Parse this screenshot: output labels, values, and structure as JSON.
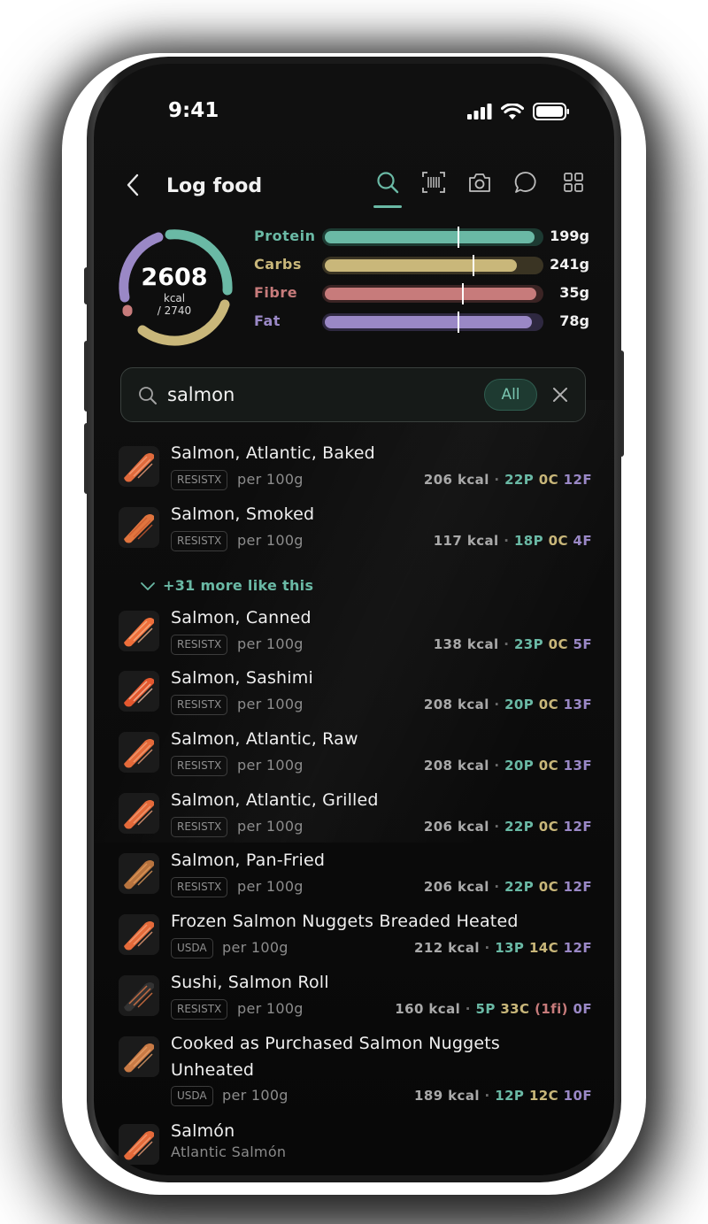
{
  "status": {
    "time": "9:41"
  },
  "header": {
    "title": "Log food"
  },
  "summary": {
    "kcal": "2608",
    "unit": "kcal",
    "goal": "/ 2740",
    "calorie_progress": 0.952
  },
  "macros": [
    {
      "label": "Protein",
      "value": "199g",
      "fill": 0.97,
      "target": 0.61,
      "color": "#6ab9a5",
      "track": "#1d3a32"
    },
    {
      "label": "Carbs",
      "value": "241g",
      "fill": 0.89,
      "target": 0.68,
      "color": "#c9b77a",
      "track": "#3a3423"
    },
    {
      "label": "Fibre",
      "value": "35g",
      "fill": 0.98,
      "target": 0.63,
      "color": "#c77b7b",
      "track": "#3b2424"
    },
    {
      "label": "Fat",
      "value": "78g",
      "fill": 0.96,
      "target": 0.61,
      "color": "#9a88c6",
      "track": "#2e2840"
    }
  ],
  "search": {
    "query": "salmon",
    "filter": "All"
  },
  "more_link": "+31 more like this",
  "foods": [
    {
      "name": "Salmon, Atlantic, Baked",
      "source": "RESISTX",
      "per": "per 100g",
      "kcal": "206 kcal",
      "p": "22P",
      "c": "0C",
      "f": "12F"
    },
    {
      "name": "Salmon, Smoked",
      "source": "RESISTX",
      "per": "per 100g",
      "kcal": "117 kcal",
      "p": "18P",
      "c": "0C",
      "f": "4F"
    },
    {
      "name": "Salmon, Canned",
      "source": "RESISTX",
      "per": "per 100g",
      "kcal": "138 kcal",
      "p": "23P",
      "c": "0C",
      "f": "5F"
    },
    {
      "name": "Salmon, Sashimi",
      "source": "RESISTX",
      "per": "per 100g",
      "kcal": "208 kcal",
      "p": "20P",
      "c": "0C",
      "f": "13F"
    },
    {
      "name": "Salmon, Atlantic, Raw",
      "source": "RESISTX",
      "per": "per 100g",
      "kcal": "208 kcal",
      "p": "20P",
      "c": "0C",
      "f": "13F"
    },
    {
      "name": "Salmon, Atlantic, Grilled",
      "source": "RESISTX",
      "per": "per 100g",
      "kcal": "206 kcal",
      "p": "22P",
      "c": "0C",
      "f": "12F"
    },
    {
      "name": "Salmon, Pan-Fried",
      "source": "RESISTX",
      "per": "per 100g",
      "kcal": "206 kcal",
      "p": "22P",
      "c": "0C",
      "f": "12F"
    },
    {
      "name": "Frozen Salmon Nuggets Breaded Heated",
      "source": "USDA",
      "per": "per 100g",
      "kcal": "212 kcal",
      "p": "13P",
      "c": "14C",
      "f": "12F"
    },
    {
      "name": "Sushi, Salmon Roll",
      "source": "RESISTX",
      "per": "per 100g",
      "kcal": "160 kcal",
      "p": "5P",
      "c": "33C",
      "fi": "(1fi)",
      "f": "0F"
    },
    {
      "name_line1": "Cooked as Purchased Salmon Nuggets",
      "name_line2": "Unheated",
      "source": "USDA",
      "per": "per 100g",
      "kcal": "189 kcal",
      "p": "12P",
      "c": "12C",
      "f": "10F"
    },
    {
      "name": "Salmón",
      "subtitle": "Atlantic Salmón"
    }
  ]
}
